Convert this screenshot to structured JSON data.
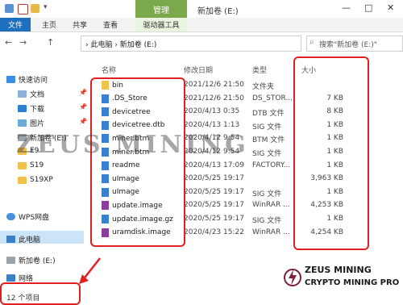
{
  "title_bar": {
    "manage_tab": "管理",
    "window_title": "新加卷 (E:)",
    "minimize": "—",
    "maximize": "□",
    "close": "✕"
  },
  "ribbon": {
    "tabs": [
      "文件",
      "主页",
      "共享",
      "查看",
      "驱动器工具"
    ]
  },
  "nav": {
    "back": "←",
    "forward": "→",
    "up": "↑",
    "breadcrumb": "› 此电脑 › 新加卷 (E:)",
    "search_placeholder": "搜索\"新加卷 (E:)\""
  },
  "sidebar": {
    "items": [
      {
        "label": "快速访问",
        "icon": "star-icon"
      },
      {
        "label": "文档",
        "icon": "document-icon"
      },
      {
        "label": "下载",
        "icon": "download-icon"
      },
      {
        "label": "图片",
        "icon": "picture-icon"
      },
      {
        "label": "新加卷 (E:)",
        "icon": "drive-icon"
      },
      {
        "label": "E9",
        "icon": "folder-icon"
      },
      {
        "label": "S19",
        "icon": "folder-icon"
      },
      {
        "label": "S19XP",
        "icon": "folder-icon"
      },
      {
        "label": "WPS网盘",
        "icon": "cloud-icon"
      },
      {
        "label": "此电脑",
        "icon": "computer-icon"
      },
      {
        "label": "新加卷 (E:)",
        "icon": "drive-icon"
      },
      {
        "label": "网络",
        "icon": "network-icon"
      }
    ]
  },
  "columns": {
    "name": "名称",
    "date": "修改日期",
    "type": "类型",
    "size": "大小"
  },
  "files": [
    {
      "name": "bin",
      "date": "2021/12/6 21:50",
      "type": "文件夹",
      "size": "",
      "icon": "folder-icon"
    },
    {
      "name": ".DS_Store",
      "date": "2021/12/6 21:50",
      "type": "DS_STOR...",
      "size": "7 KB",
      "icon": "file-icon"
    },
    {
      "name": "devicetree",
      "date": "2020/4/13 0:35",
      "type": "DTB 文件",
      "size": "8 KB",
      "icon": "file-icon"
    },
    {
      "name": "devicetree.dtb",
      "date": "2020/4/13 1:13",
      "type": "SIG 文件",
      "size": "1 KB",
      "icon": "file-icon"
    },
    {
      "name": "miner.btm",
      "date": "2020/4/12 9:54",
      "type": "BTM 文件",
      "size": "1 KB",
      "icon": "file-icon"
    },
    {
      "name": "miner.btm",
      "date": "2020/4/12 9:54",
      "type": "SIG 文件",
      "size": "1 KB",
      "icon": "file-icon"
    },
    {
      "name": "readme",
      "date": "2020/4/13 17:09",
      "type": "FACTORY...",
      "size": "1 KB",
      "icon": "file-icon"
    },
    {
      "name": "uImage",
      "date": "2020/5/25 19:17",
      "type": "",
      "size": "3,963 KB",
      "icon": "file-icon"
    },
    {
      "name": "uImage",
      "date": "2020/5/25 19:17",
      "type": "SIG 文件",
      "size": "1 KB",
      "icon": "file-icon"
    },
    {
      "name": "update.image",
      "date": "2020/5/25 19:17",
      "type": "WinRAR ...",
      "size": "4,253 KB",
      "icon": "archive-icon"
    },
    {
      "name": "update.image.gz",
      "date": "2020/5/25 19:17",
      "type": "SIG 文件",
      "size": "1 KB",
      "icon": "file-icon"
    },
    {
      "name": "uramdisk.image",
      "date": "2020/4/23 15:22",
      "type": "WinRAR ...",
      "size": "4,254 KB",
      "icon": "archive-icon"
    }
  ],
  "status": {
    "item_count": "12 个项目"
  },
  "watermark": "ZEUS MINING",
  "brand": {
    "line1": "ZEUS MINING",
    "line2": "CRYPTO MINING PRO"
  },
  "colors": {
    "accent": "#1f6fbf",
    "manage": "#7aa84a",
    "highlight": "#e02020",
    "selected": "#cce4f7"
  }
}
